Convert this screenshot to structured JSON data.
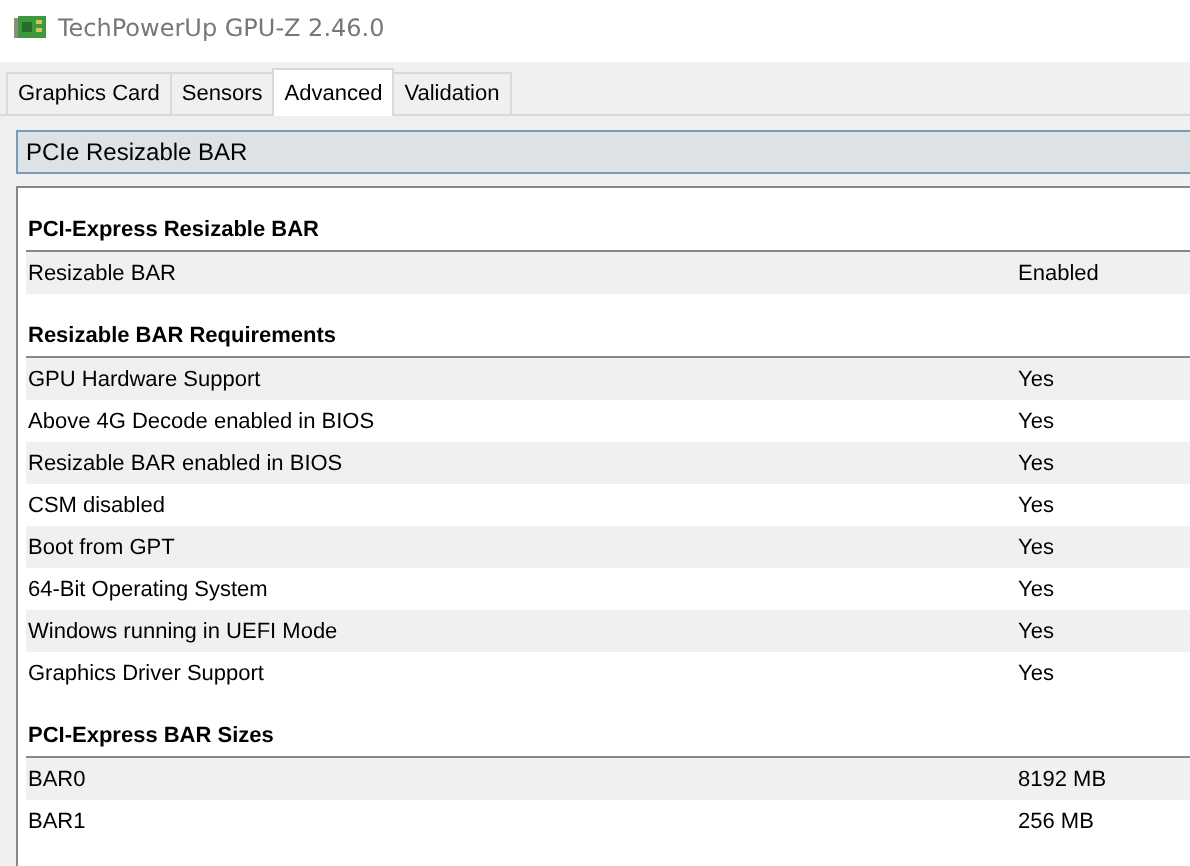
{
  "window": {
    "title": "TechPowerUp GPU-Z 2.46.0"
  },
  "tabs": [
    {
      "label": "Graphics Card",
      "selected": false
    },
    {
      "label": "Sensors",
      "selected": false
    },
    {
      "label": "Advanced",
      "selected": true
    },
    {
      "label": "Validation",
      "selected": false
    }
  ],
  "dropdown": {
    "value": "PCIe Resizable BAR"
  },
  "sections": [
    {
      "title": "PCI-Express Resizable BAR",
      "rows": [
        {
          "label": "Resizable BAR",
          "value": "Enabled"
        }
      ]
    },
    {
      "title": "Resizable BAR Requirements",
      "rows": [
        {
          "label": "GPU Hardware Support",
          "value": "Yes"
        },
        {
          "label": "Above 4G Decode enabled in BIOS",
          "value": "Yes"
        },
        {
          "label": "Resizable BAR enabled in BIOS",
          "value": "Yes"
        },
        {
          "label": "CSM disabled",
          "value": "Yes"
        },
        {
          "label": "Boot from GPT",
          "value": "Yes"
        },
        {
          "label": "64-Bit Operating System",
          "value": "Yes"
        },
        {
          "label": "Windows running in UEFI Mode",
          "value": "Yes"
        },
        {
          "label": "Graphics Driver Support",
          "value": "Yes"
        }
      ]
    },
    {
      "title": "PCI-Express BAR Sizes",
      "rows": [
        {
          "label": "BAR0",
          "value": "8192 MB"
        },
        {
          "label": "BAR1",
          "value": "256 MB"
        }
      ]
    }
  ]
}
